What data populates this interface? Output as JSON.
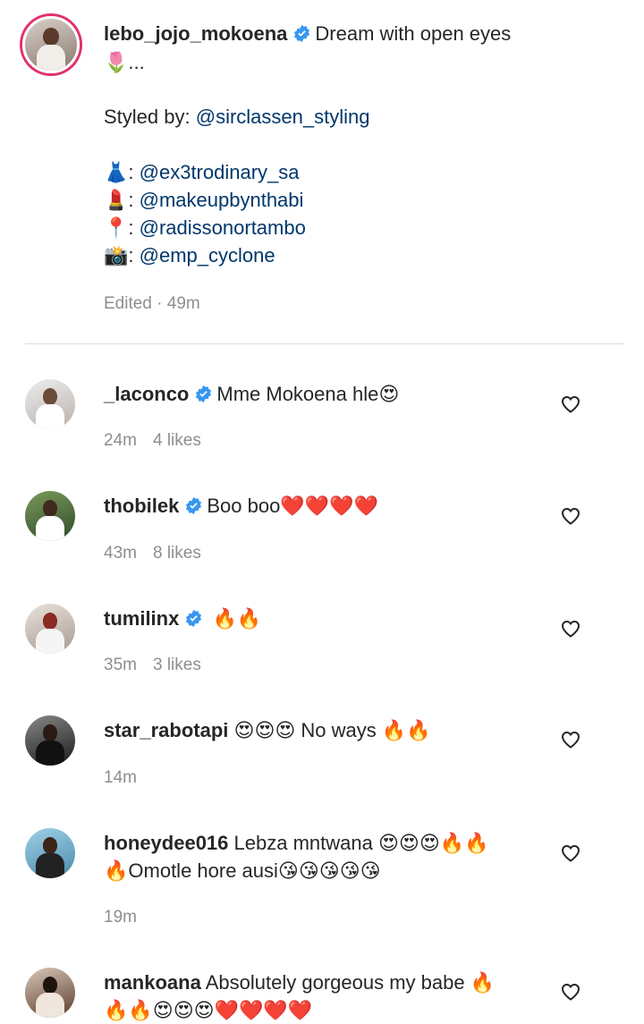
{
  "post": {
    "username": "lebo_jojo_mokoena",
    "caption_lines": [
      "Dream with open eyes",
      "🌷..."
    ],
    "styled_by_label": "Styled by:",
    "styled_by_mention": "@sirclassen_styling",
    "credits": [
      {
        "emoji": "👗",
        "sep": ": ",
        "mention": "@ex3trodinary_sa"
      },
      {
        "emoji": "💄",
        "sep": ": ",
        "mention": "@makeupbynthabi"
      },
      {
        "emoji": "📍",
        "sep": ": ",
        "mention": "@radissonortambo"
      },
      {
        "emoji": "📸",
        "sep": ": ",
        "mention": "@emp_cyclone"
      }
    ],
    "edited": "Edited · 49m"
  },
  "comments": [
    {
      "username": "_laconco",
      "verified": true,
      "lines": [
        "Mme Mokoena hle😍"
      ],
      "time": "24m",
      "likes": "4 likes"
    },
    {
      "username": "thobilek",
      "verified": true,
      "lines": [
        "Boo boo❤️❤️❤️❤️"
      ],
      "time": "43m",
      "likes": "8 likes"
    },
    {
      "username": "tumilinx",
      "verified": true,
      "lines": [
        " 🔥🔥"
      ],
      "time": "35m",
      "likes": "3 likes"
    },
    {
      "username": "star_rabotapi",
      "verified": false,
      "lines": [
        " 😍😍😍 No ways 🔥🔥"
      ],
      "time": "14m",
      "likes": ""
    },
    {
      "username": "honeydee016",
      "verified": false,
      "lines": [
        " Lebza mntwana 😍😍😍🔥🔥",
        "🔥Omotle hore ausi😘😘😘😘😘"
      ],
      "time": "19m",
      "likes": ""
    },
    {
      "username": "mankoana",
      "verified": false,
      "lines": [
        " Absolutely gorgeous my babe 🔥",
        "🔥🔥😍😍😍❤️❤️❤️❤️"
      ],
      "time": "",
      "likes": ""
    }
  ],
  "colors": {
    "mention": "#00376b",
    "verified": "#3897f0",
    "meta": "#8e8e8e",
    "ring": "#e1306c"
  }
}
